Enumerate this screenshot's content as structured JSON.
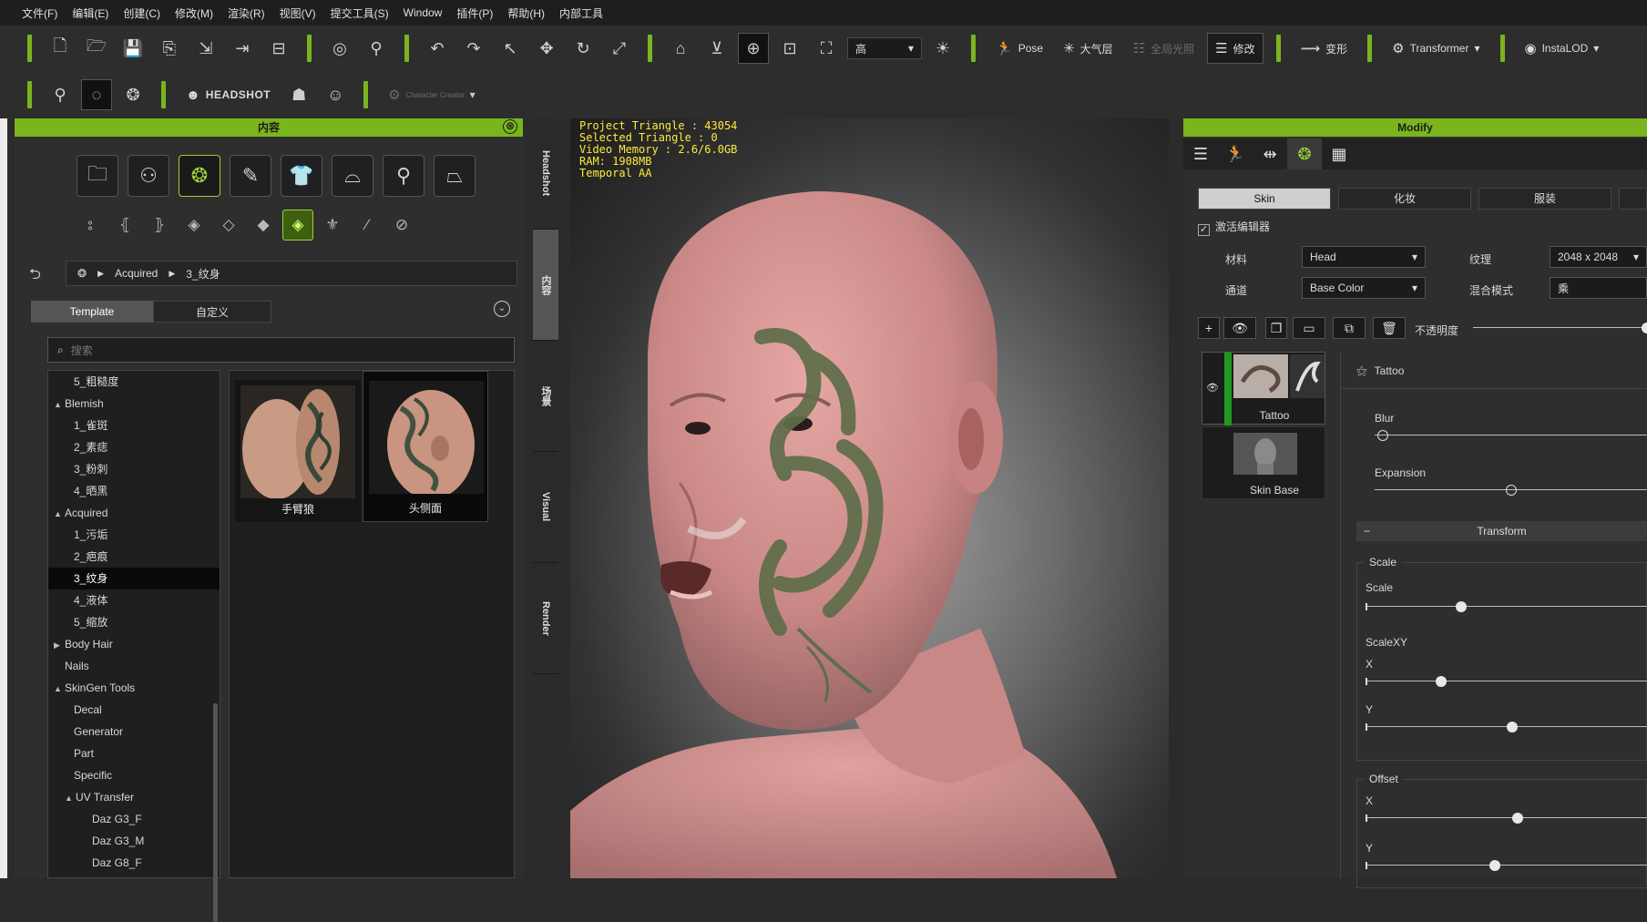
{
  "menu": [
    "文件(F)",
    "编辑(E)",
    "创建(C)",
    "修改(M)",
    "渲染(R)",
    "视图(V)",
    "提交工具(S)",
    "Window",
    "插件(P)",
    "帮助(H)",
    "内部工具"
  ],
  "toolbar": {
    "quality_value": "高",
    "pose_label": "Pose",
    "atmosphere_label": "大气层",
    "dim_label": "全局光照",
    "modify_label": "修改",
    "morph_label": "变形",
    "transformer_label": "Transformer",
    "instalod_label": "InstaLOD"
  },
  "toolbar2": {
    "headshot_label": "HEADSHOT",
    "dim_label": "Character Creator"
  },
  "content": {
    "title": "内容",
    "breadcrumb": [
      "Acquired",
      "3_纹身"
    ],
    "tabs": [
      "Template",
      "自定义"
    ],
    "search_placeholder": "搜索",
    "tree": [
      {
        "label": "5_粗糙度",
        "level": 2,
        "arrow": ""
      },
      {
        "label": "Blemish",
        "level": 1,
        "arrow": "▲"
      },
      {
        "label": "1_雀斑",
        "level": 2,
        "arrow": ""
      },
      {
        "label": "2_素痣",
        "level": 2,
        "arrow": ""
      },
      {
        "label": "3_粉刺",
        "level": 2,
        "arrow": ""
      },
      {
        "label": "4_晒黑",
        "level": 2,
        "arrow": ""
      },
      {
        "label": "Acquired",
        "level": 1,
        "arrow": "▲"
      },
      {
        "label": "1_污垢",
        "level": 2,
        "arrow": ""
      },
      {
        "label": "2_疤痕",
        "level": 2,
        "arrow": ""
      },
      {
        "label": "3_纹身",
        "level": 2,
        "arrow": "",
        "selected": true
      },
      {
        "label": "4_液体",
        "level": 2,
        "arrow": ""
      },
      {
        "label": "5_缩放",
        "level": 2,
        "arrow": ""
      },
      {
        "label": "Body Hair",
        "level": 1,
        "arrow": "▶"
      },
      {
        "label": "Nails",
        "level": 1,
        "arrow": ""
      },
      {
        "label": "SkinGen Tools",
        "level": 1,
        "arrow": "▲"
      },
      {
        "label": "Decal",
        "level": 2,
        "arrow": ""
      },
      {
        "label": "Generator",
        "level": 2,
        "arrow": ""
      },
      {
        "label": "Part",
        "level": 2,
        "arrow": ""
      },
      {
        "label": "Specific",
        "level": 2,
        "arrow": ""
      },
      {
        "label": "UV Transfer",
        "level": 2,
        "arrow": "▲"
      },
      {
        "label": "Daz G3_F",
        "level": 3,
        "arrow": ""
      },
      {
        "label": "Daz G3_M",
        "level": 3,
        "arrow": ""
      },
      {
        "label": "Daz G8_F",
        "level": 3,
        "arrow": ""
      }
    ],
    "thumbnails": [
      "手臂狼",
      "头侧面"
    ]
  },
  "vtabs": [
    "Headshot",
    "内容",
    "场景",
    "Visual",
    "Render"
  ],
  "viewport": {
    "stats": [
      "Project Triangle : 43054",
      "Selected Triangle : 0",
      "Video Memory : 2.6/6.0GB",
      "RAM: 1908MB",
      "Temporal AA"
    ]
  },
  "modify": {
    "title": "Modify",
    "tabs": [
      "Skin",
      "化妆",
      "服装"
    ],
    "activate_editor": "激活编辑器",
    "material_label": "材料",
    "material_value": "Head",
    "texture_label": "纹理",
    "texture_value": "2048 x 2048",
    "channel_label": "通道",
    "channel_value": "Base Color",
    "blend_label": "混合模式",
    "blend_value": "乘",
    "opacity_label": "不透明度",
    "opacity_value": 1.0,
    "layers": [
      "Tattoo",
      "Skin Base"
    ],
    "section_title": "Tattoo",
    "blur_label": "Blur",
    "blur_value": 0.03,
    "expansion_label": "Expansion",
    "expansion_value": 0.5,
    "transform_label": "Transform",
    "scale_group": "Scale",
    "scale_label": "Scale",
    "scale_value": 0.34,
    "scalexy_label": "ScaleXY",
    "x_label": "X",
    "x_value": 0.27,
    "y_label": "Y",
    "y_value": 0.52,
    "offset_group": "Offset",
    "offset_x_label": "X",
    "offset_x_value": 0.54,
    "offset_y_label": "Y",
    "offset_y_value": 0.46
  },
  "colors": {
    "accent": "#7ab51d",
    "stats": "#ffea3d",
    "layer_active": "#1e9a1e"
  }
}
